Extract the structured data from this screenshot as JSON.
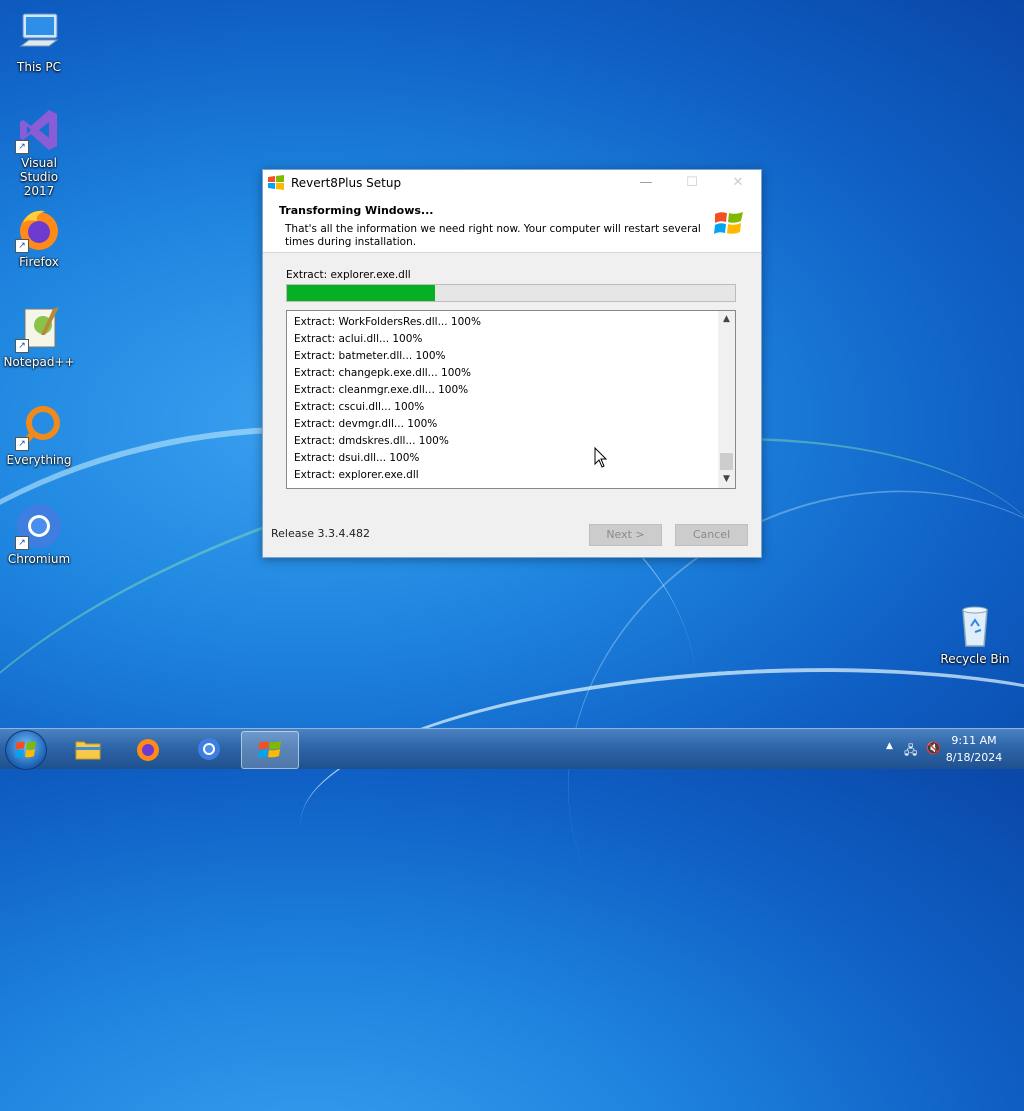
{
  "desktop": {
    "icons": [
      {
        "label": "This PC"
      },
      {
        "label": "Visual Studio\n2017"
      },
      {
        "label": "Firefox"
      },
      {
        "label": "Notepad++"
      },
      {
        "label": "Everything"
      },
      {
        "label": "Chromium"
      },
      {
        "label": "Recycle Bin"
      }
    ]
  },
  "dialog": {
    "title": "Revert8Plus Setup",
    "header_title": "Transforming Windows...",
    "header_text": "That's all the information we need right now. Your computer will restart several times during installation.",
    "status_text": "Extract: explorer.exe.dll",
    "progress_fraction": 0.33,
    "log": [
      "Extract: WorkFoldersRes.dll... 100%",
      "Extract: aclui.dll... 100%",
      "Extract: batmeter.dll... 100%",
      "Extract: changepk.exe.dll... 100%",
      "Extract: cleanmgr.exe.dll... 100%",
      "Extract: cscui.dll... 100%",
      "Extract: devmgr.dll... 100%",
      "Extract: dmdskres.dll... 100%",
      "Extract: dsui.dll... 100%",
      "Extract: explorer.exe.dll"
    ],
    "release": "Release 3.3.4.482",
    "next_label": "Next >",
    "cancel_label": "Cancel",
    "minimize_glyph": "—",
    "maximize_glyph": "☐",
    "close_glyph": "✕"
  },
  "taskbar": {
    "items": [
      "windows-start-icon",
      "file-explorer-icon",
      "firefox-icon",
      "chromium-icon",
      "revert8plus-icon"
    ],
    "time": "9:11 AM",
    "date": "8/18/2024"
  },
  "colors": {
    "progress": "#06b025",
    "accent": "#1f86e0"
  }
}
